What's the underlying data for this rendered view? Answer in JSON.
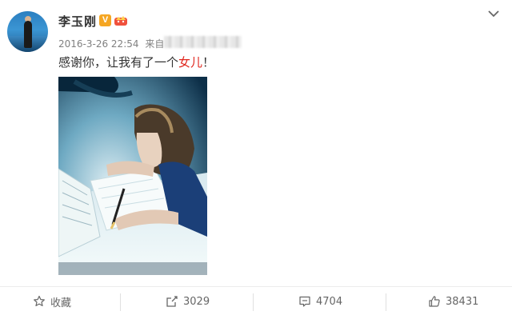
{
  "user": {
    "name": "李玉刚",
    "verified_badge": "V"
  },
  "post": {
    "timestamp": "2016-3-26 22:54",
    "source_label": "来自",
    "text_before": "感谢你，让我有了一个",
    "text_highlight": "女儿",
    "text_after": "！",
    "highlight_color": "#e0261d"
  },
  "actions": [
    {
      "icon": "star-icon",
      "label": "收藏"
    },
    {
      "icon": "share-icon",
      "label": "3029"
    },
    {
      "icon": "comment-icon",
      "label": "4704"
    },
    {
      "icon": "like-icon",
      "label": "38431"
    }
  ],
  "colors": {
    "verified": "#f5a623",
    "text": "#333333",
    "meta": "#808080"
  }
}
